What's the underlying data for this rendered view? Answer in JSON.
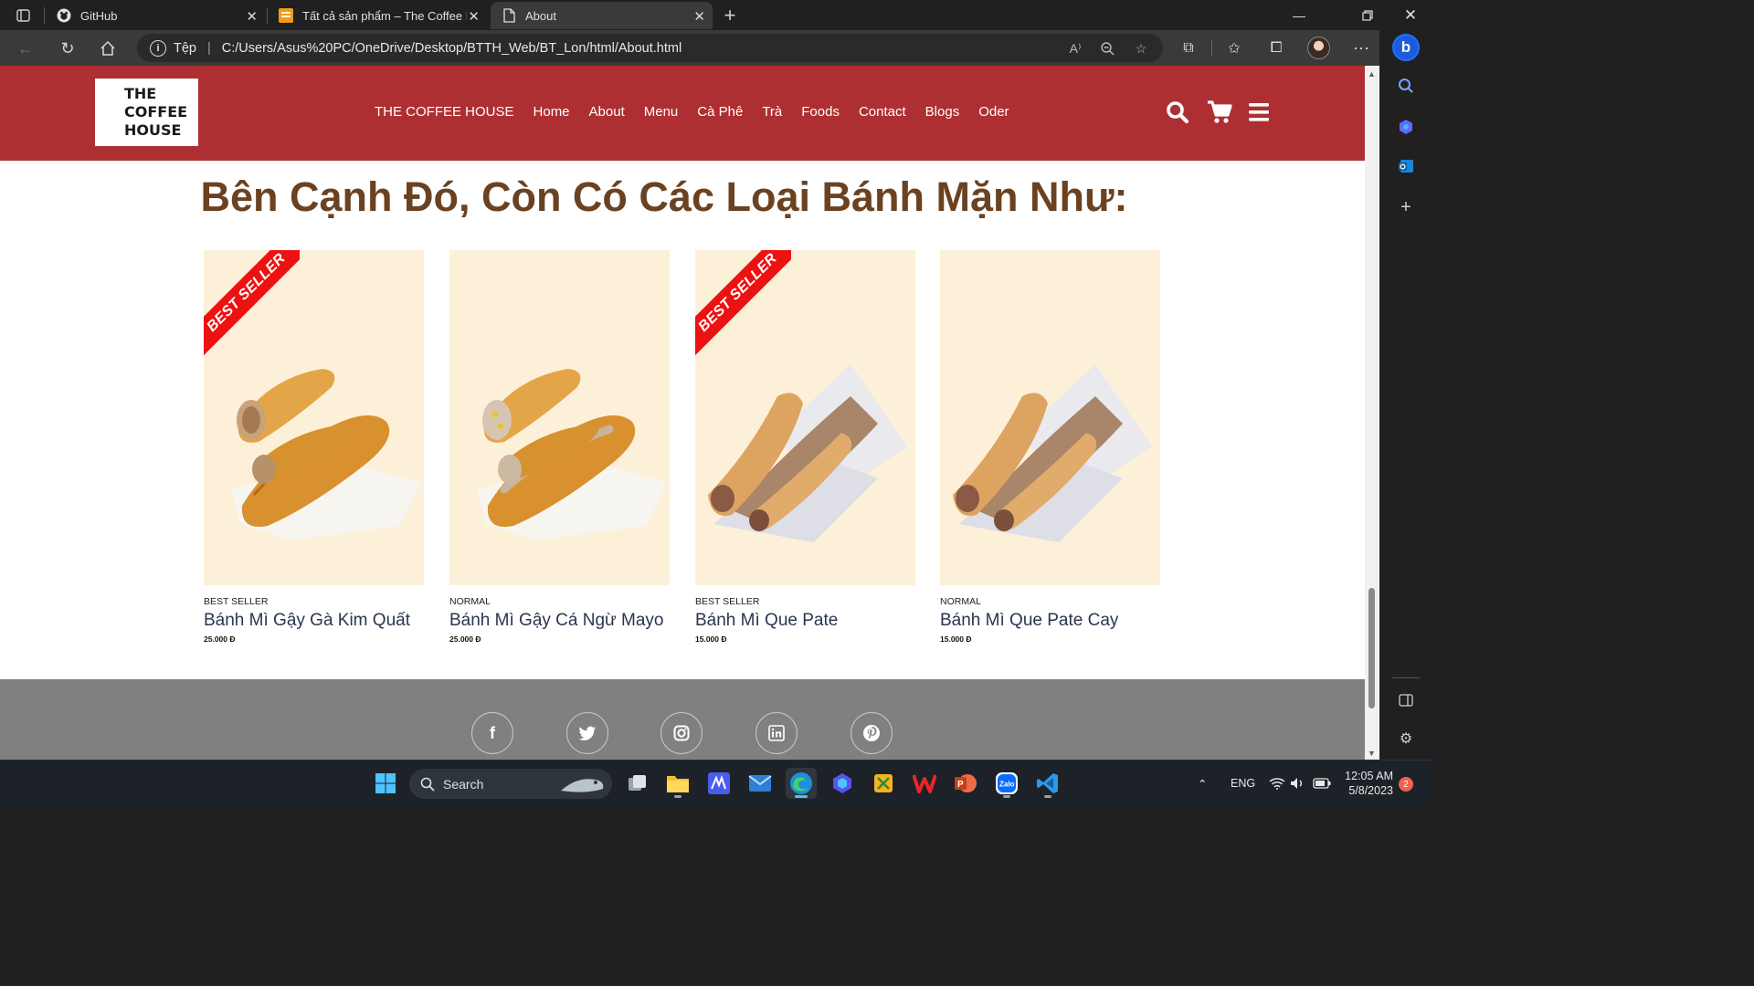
{
  "browser": {
    "tabs": [
      {
        "title": "GitHub",
        "icon": "github-icon",
        "active": false
      },
      {
        "title": "Tất cả sản phẩm – The Coffee Ho",
        "icon": "coffee-favicon-icon",
        "active": false
      },
      {
        "title": "About",
        "icon": "page-icon",
        "active": true
      }
    ],
    "address": {
      "scheme_label": "Tệp",
      "url": "C:/Users/Asus%20PC/OneDrive/Desktop/BTTH_Web/BT_Lon/html/About.html"
    }
  },
  "site": {
    "logo_lines": [
      "THE",
      "COFFEE",
      "HOUSE"
    ],
    "nav": [
      "THE COFFEE HOUSE",
      "Home",
      "About",
      "Menu",
      "Cà Phê",
      "Trà",
      "Foods",
      "Contact",
      "Blogs",
      "Oder"
    ],
    "section_title": "Bên Cạnh Đó, Còn Có Các Loại Bánh Mặn Như:",
    "ribbon_text": "BEST SELLER",
    "products": [
      {
        "tag": "BEST SELLER",
        "name": "Bánh Mì Gậy Gà Kim Quất",
        "price": "25.000 Đ",
        "ribbon": true,
        "kind": "baguette-chicken"
      },
      {
        "tag": "NORMAL",
        "name": "Bánh Mì Gậy Cá Ngừ Mayo",
        "price": "25.000 Đ",
        "ribbon": false,
        "kind": "baguette-tuna"
      },
      {
        "tag": "BEST SELLER",
        "name": "Bánh Mì Que Pate",
        "price": "15.000 Đ",
        "ribbon": true,
        "kind": "pate-stick"
      },
      {
        "tag": "NORMAL",
        "name": "Bánh Mì Que Pate Cay",
        "price": "15.000 Đ",
        "ribbon": false,
        "kind": "pate-stick"
      }
    ],
    "social": [
      "facebook-icon",
      "twitter-icon",
      "instagram-icon",
      "linkedin-icon",
      "pinterest-icon"
    ]
  },
  "taskbar": {
    "search_label": "Search",
    "language": "ENG",
    "time": "12:05 AM",
    "date": "5/8/2023",
    "notification_count": "2"
  },
  "colors": {
    "header_red": "#ae2f32",
    "title_brown": "#6b4221",
    "card_bg": "#fdf0d8",
    "ribbon_red": "#ee1111",
    "footer_gray": "#808080"
  }
}
